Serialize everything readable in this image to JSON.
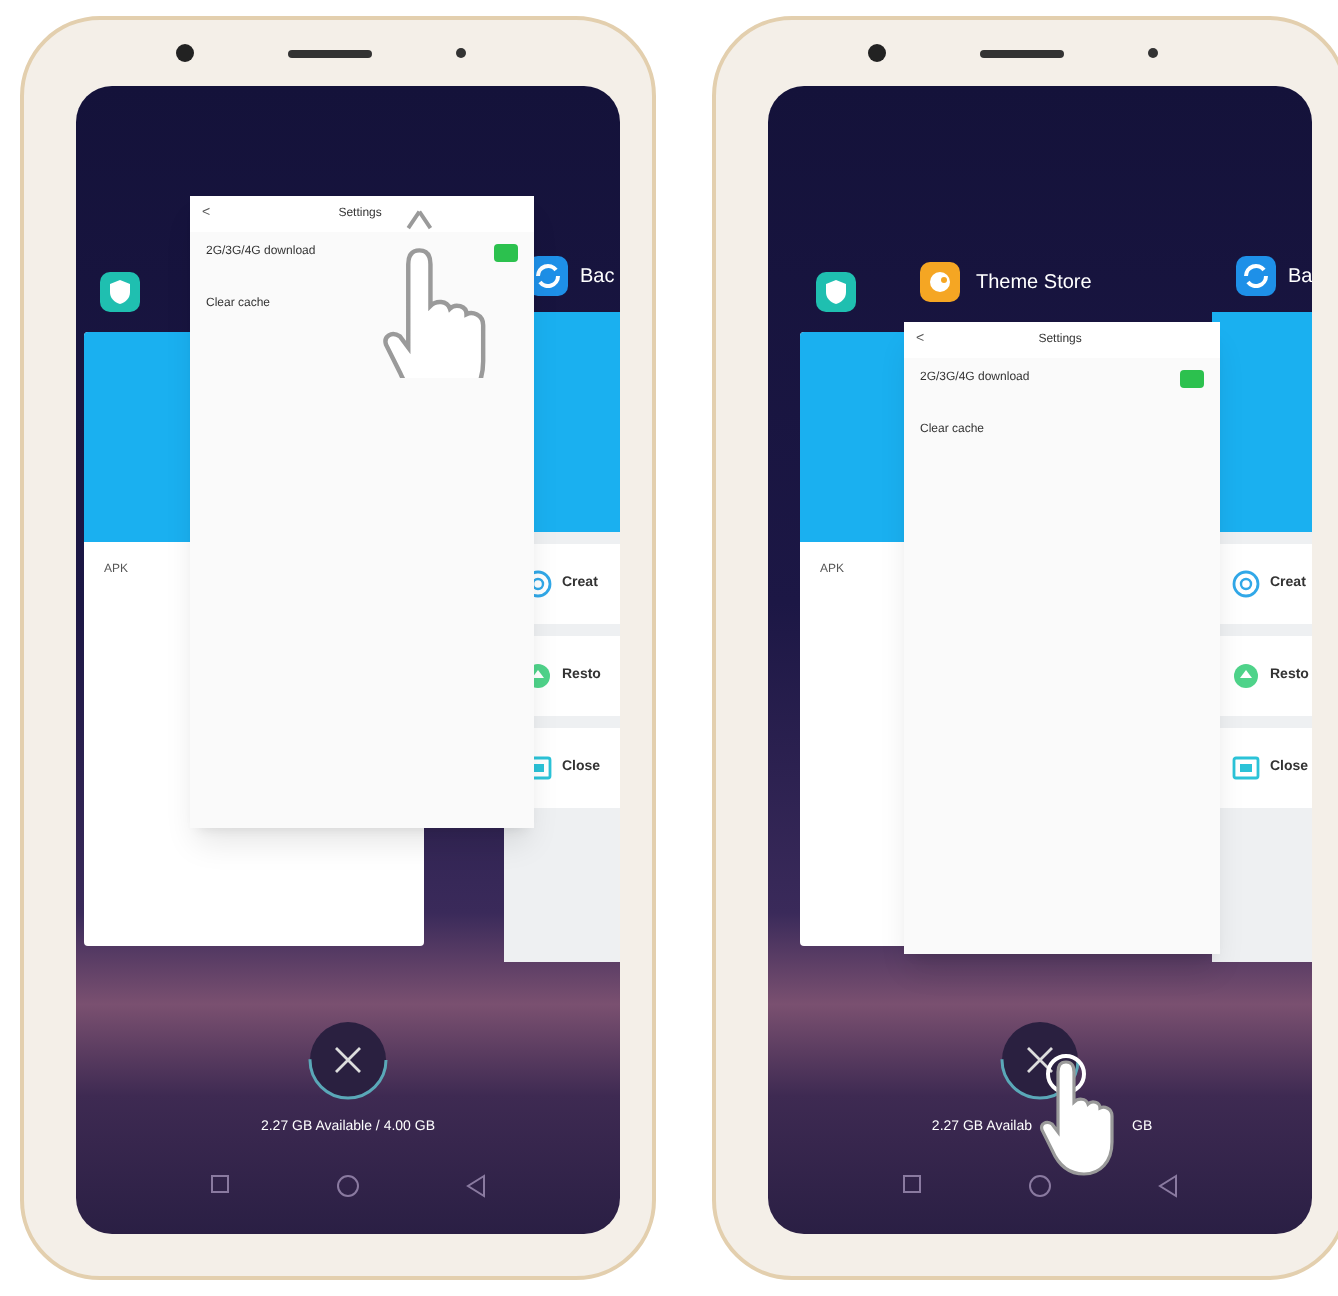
{
  "phones": [
    {
      "kind": "swipe-up",
      "left_card": {
        "items": [
          "APK"
        ]
      },
      "front_card": {
        "lifted": true,
        "title": "Settings",
        "back": "<",
        "rows": [
          {
            "label": "2G/3G/4G download",
            "switch_on": true
          },
          {
            "label": "Clear cache"
          }
        ]
      },
      "right_card": {
        "app_label": "Bac",
        "items": [
          "Creat",
          "Resto",
          "Close"
        ]
      },
      "memory_text": [
        "2.27 GB Available / 4.00 GB"
      ]
    },
    {
      "kind": "tap",
      "left_card": {
        "items": [
          "APK"
        ]
      },
      "front_card": {
        "lifted": false,
        "app_label": "Theme Store",
        "title": "Settings",
        "back": "<",
        "rows": [
          {
            "label": "2G/3G/4G download",
            "switch_on": true
          },
          {
            "label": "Clear cache"
          }
        ]
      },
      "right_card": {
        "app_label": "Ba",
        "items": [
          "Creat",
          "Resto",
          "Close"
        ]
      },
      "memory_text": [
        "2.27 GB Availab",
        "GB"
      ]
    }
  ]
}
